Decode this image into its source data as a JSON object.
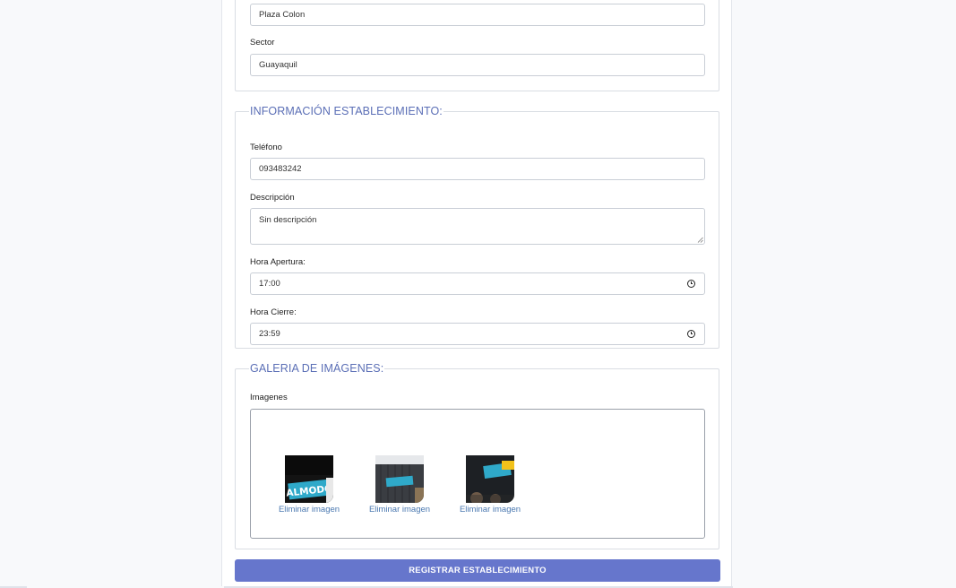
{
  "location": {
    "address_value": "Plaza Colon",
    "sector_label": "Sector",
    "sector_value": "Guayaquil"
  },
  "info": {
    "legend": "INFORMACIÓN ESTABLECIMIENTO:",
    "phone_label": "Teléfono",
    "phone_value": "093483242",
    "description_label": "Descripción",
    "description_value": "Sin descripción",
    "open_label": "Hora Apertura:",
    "open_value": "17:00",
    "close_label": "Hora Cierre:",
    "close_value": "23:59"
  },
  "gallery": {
    "legend": "GALERIA DE IMÁGENES:",
    "images_label": "Imagenes",
    "remove_label": "Eliminar imagen",
    "logo_text": "ALMODO",
    "image_count": 3
  },
  "submit_label": "REGISTRAR ESTABLECIMIENTO",
  "colors": {
    "accent": "#6676cc",
    "legend": "#5b6fb6",
    "link": "#4a78b0",
    "sign_teal": "#2fa9c9"
  }
}
